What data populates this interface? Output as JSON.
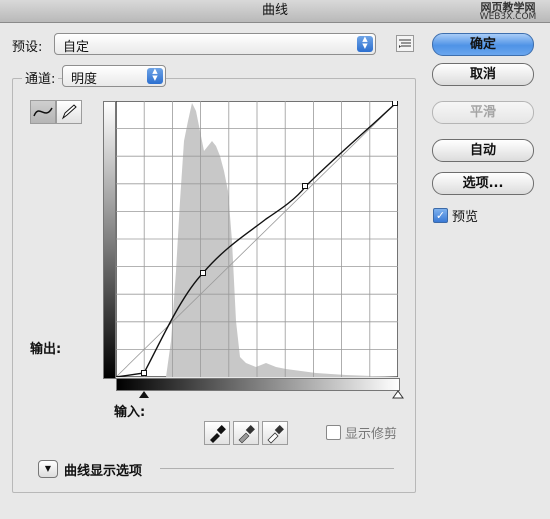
{
  "window": {
    "title": "曲线"
  },
  "watermark": {
    "line1": "网页教学网",
    "line2": "WEB3X.COM"
  },
  "preset": {
    "label": "预设:",
    "value": "自定"
  },
  "channel": {
    "label": "通道:",
    "value": "明度"
  },
  "buttons": {
    "ok": "确定",
    "cancel": "取消",
    "smooth": "平滑",
    "auto": "自动",
    "options": "选项..."
  },
  "preview": {
    "label": "预览",
    "checked": true
  },
  "curve": {
    "output_label": "输出:",
    "input_label": "输入:"
  },
  "show_clipping": {
    "label": "显示修剪",
    "checked": false
  },
  "curve_display": {
    "label": "曲线显示选项"
  },
  "colors": {
    "accent": "#4f93e6",
    "histogram": "#c8c8c8",
    "curve": "#000000"
  }
}
